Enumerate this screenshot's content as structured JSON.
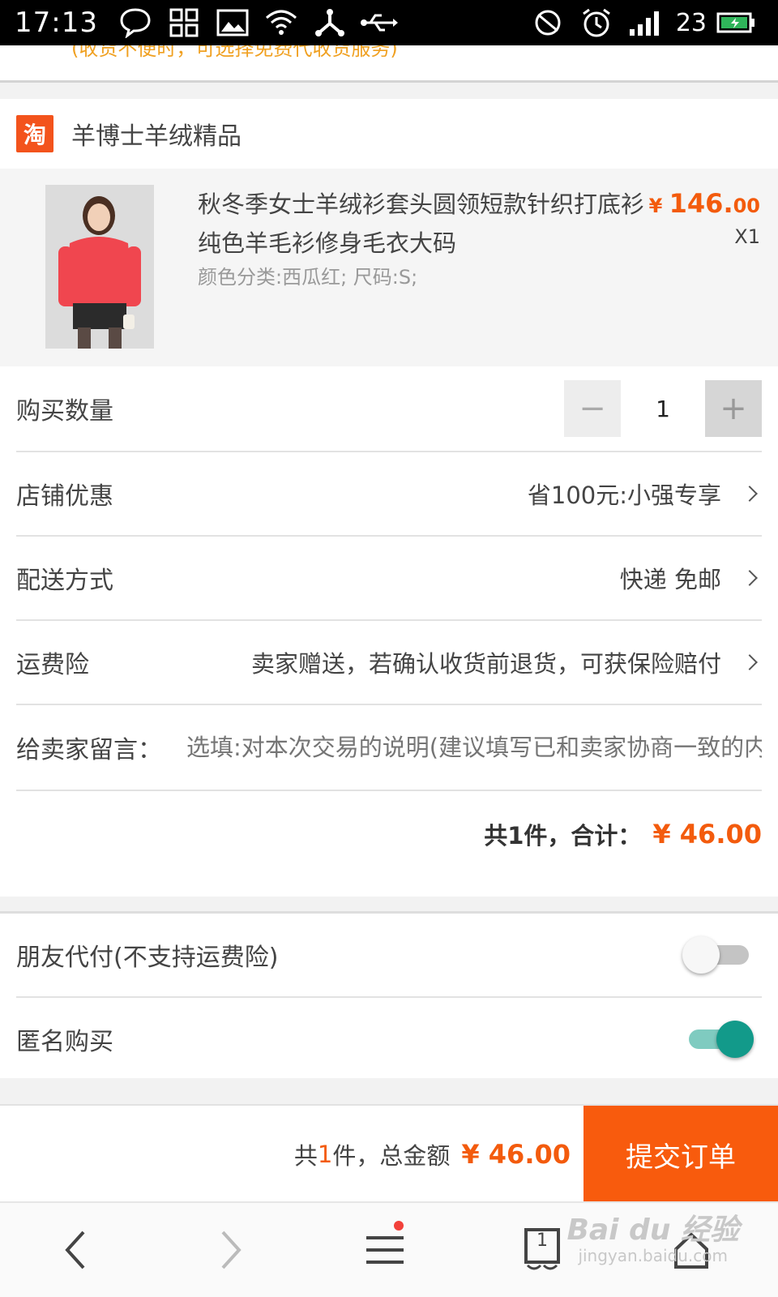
{
  "status_bar": {
    "time": "17:13",
    "network_label": "23"
  },
  "top_notice": "(收货不便时，可选择免费代收货服务)",
  "shop": {
    "icon_text": "淘",
    "name": "羊博士羊绒精品"
  },
  "product": {
    "title": "秋冬季女士羊绒衫套头圆领短款针织打底衫纯色羊毛衫修身毛衣大码",
    "attributes": "颜色分类:西瓜红; 尺码:S;",
    "price_currency": "¥ ",
    "price_int": "146.",
    "price_dec": "00",
    "quantity": "X1"
  },
  "form": {
    "quantity_label": "购买数量",
    "quantity_value": "1",
    "minus_symbol": "−",
    "plus_symbol": "+",
    "discount_label": "店铺优惠",
    "discount_value": "省100元:小强专享",
    "delivery_label": "配送方式",
    "delivery_value": "快递 免邮",
    "insurance_label": "运费险",
    "insurance_value": "卖家赠送，若确认收货前退货，可获保险赔付",
    "message_label": "给卖家留言：",
    "message_placeholder": "选填:对本次交易的说明(建议填写已和卖家协商一致的内容)",
    "total_label": "共1件，合计：",
    "total_amount": "¥ 46.00"
  },
  "options": {
    "friend_pay_label": "朋友代付(不支持运费险)",
    "friend_pay_on": false,
    "anonymous_label": "匿名购买",
    "anonymous_on": true
  },
  "submit_bar": {
    "summary_prefix": "共",
    "summary_count": "1",
    "summary_suffix": "件，总金额",
    "total_amount": "¥ 46.00",
    "submit_label": "提交订单"
  },
  "browser_nav": {
    "tab_count": "1"
  },
  "watermark": {
    "main": "Bai du 经验",
    "sub": "jingyan.baidu.com"
  },
  "colors": {
    "accent": "#f85b0d",
    "toggle_on": "#129a8a"
  }
}
